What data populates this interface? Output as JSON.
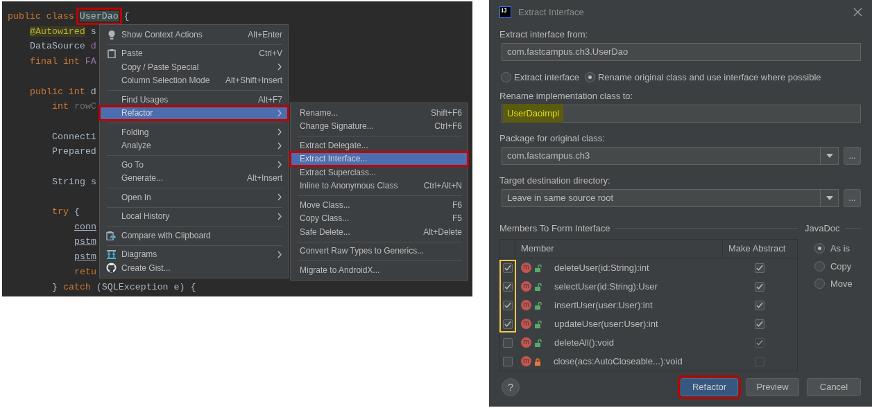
{
  "editor": {
    "code_lines": [
      {
        "tokens": [
          {
            "text": "public class",
            "kind": "keyword"
          },
          {
            "text": "UserDao",
            "kind": "plain",
            "selected": true,
            "outlined": true
          },
          {
            "text": "{",
            "kind": "plain"
          }
        ],
        "children": [
          {
            "tokens": [
              {
                "text": "@Autowired",
                "kind": "annotation"
              },
              {
                "text": "s",
                "kind": "plain"
              }
            ]
          },
          {
            "tokens": [
              {
                "text": "DataSource",
                "kind": "plain"
              },
              {
                "text": "d",
                "kind": "field"
              }
            ]
          },
          {
            "tokens": [
              {
                "text": "final int",
                "kind": "keyword"
              },
              {
                "text": "FA",
                "kind": "field"
              }
            ]
          },
          {
            "blank_before": true,
            "tokens": [
              {
                "text": "public int",
                "kind": "keyword"
              },
              {
                "text": "d",
                "kind": "plain"
              }
            ],
            "children": [
              {
                "tokens": [
                  {
                    "text": "int",
                    "kind": "keyword"
                  },
                  {
                    "text": "rowC",
                    "kind": "unused"
                  }
                ]
              },
              {
                "blank_before": true,
                "tokens": [
                  {
                    "text": "Connecti",
                    "kind": "plain"
                  }
                ]
              },
              {
                "tokens": [
                  {
                    "text": "Prepared",
                    "kind": "plain"
                  }
                ]
              },
              {
                "blank_before": true,
                "tokens": [
                  {
                    "text": "String",
                    "kind": "plain"
                  },
                  {
                    "text": "s",
                    "kind": "plain"
                  }
                ]
              },
              {
                "blank_before": true,
                "tokens": [
                  {
                    "text": "try",
                    "kind": "keyword"
                  },
                  {
                    "text": "{",
                    "kind": "plain"
                  }
                ],
                "children": [
                  {
                    "tokens": [
                      {
                        "text": "conn",
                        "kind": "linked"
                      }
                    ]
                  },
                  {
                    "tokens": [
                      {
                        "text": "pstm",
                        "kind": "linked"
                      }
                    ]
                  },
                  {
                    "tokens": [
                      {
                        "text": "pstm",
                        "kind": "linked"
                      }
                    ]
                  },
                  {
                    "tokens": [
                      {
                        "text": "retu",
                        "kind": "keyword"
                      }
                    ]
                  }
                ]
              },
              {
                "tokens": [
                  {
                    "text": "}",
                    "kind": "plain"
                  },
                  {
                    "text": "catch",
                    "kind": "keyword"
                  },
                  {
                    "text": "(SQLException e) {",
                    "kind": "plain"
                  }
                ]
              }
            ]
          }
        ]
      }
    ]
  },
  "context_menu": {
    "groups": [
      [
        {
          "label": "Show Context Actions",
          "shortcut": "Alt+Enter",
          "kind": "bulb",
          "has_submenu": false,
          "selected": false
        }
      ],
      [
        {
          "label": "Paste",
          "shortcut": "Ctrl+V",
          "kind": "clipboard",
          "has_submenu": false,
          "selected": false
        },
        {
          "label": "Copy / Paste Special",
          "kind": "plain",
          "has_submenu": true,
          "selected": false
        },
        {
          "label": "Column Selection Mode",
          "shortcut": "Alt+Shift+Insert",
          "kind": "plain",
          "has_submenu": false,
          "selected": false
        }
      ],
      [
        {
          "label": "Find Usages",
          "shortcut": "Alt+F7",
          "kind": "plain",
          "has_submenu": false,
          "selected": false
        },
        {
          "label": "Refactor",
          "kind": "plain",
          "has_submenu": true,
          "selected": true,
          "outlined": true
        }
      ],
      [
        {
          "label": "Folding",
          "kind": "plain",
          "has_submenu": true,
          "selected": false
        },
        {
          "label": "Analyze",
          "kind": "plain",
          "has_submenu": true,
          "selected": false
        }
      ],
      [
        {
          "label": "Go To",
          "kind": "plain",
          "has_submenu": true,
          "selected": false
        },
        {
          "label": "Generate...",
          "shortcut": "Alt+Insert",
          "kind": "plain",
          "has_submenu": false,
          "selected": false
        }
      ],
      [
        {
          "label": "Open In",
          "kind": "plain",
          "has_submenu": true,
          "selected": false
        }
      ],
      [
        {
          "label": "Local History",
          "kind": "plain",
          "has_submenu": true,
          "selected": false
        }
      ],
      [
        {
          "label": "Compare with Clipboard",
          "kind": "compare",
          "has_submenu": false,
          "selected": false
        }
      ],
      [
        {
          "label": "Diagrams",
          "kind": "diagram",
          "has_submenu": true,
          "selected": false
        },
        {
          "label": "Create Gist...",
          "kind": "gist",
          "has_submenu": false,
          "selected": false
        }
      ]
    ]
  },
  "submenu": {
    "groups": [
      [
        {
          "label": "Rename...",
          "shortcut": "Shift+F6",
          "selected": false
        },
        {
          "label": "Change Signature...",
          "shortcut": "Ctrl+F6",
          "selected": false
        }
      ],
      [
        {
          "label": "Extract Delegate...",
          "selected": false
        },
        {
          "label": "Extract Interface...",
          "selected": true,
          "outlined": true
        },
        {
          "label": "Extract Superclass...",
          "selected": false
        },
        {
          "label": "Inline to Anonymous Class",
          "shortcut": "Ctrl+Alt+N",
          "selected": false
        }
      ],
      [
        {
          "label": "Move Class...",
          "shortcut": "F6",
          "selected": false
        },
        {
          "label": "Copy Class...",
          "shortcut": "F5",
          "selected": false
        },
        {
          "label": "Safe Delete...",
          "shortcut": "Alt+Delete",
          "selected": false
        }
      ],
      [
        {
          "label": "Convert Raw Types to Generics...",
          "selected": false
        }
      ],
      [
        {
          "label": "Migrate to AndroidX...",
          "selected": false
        }
      ]
    ]
  },
  "dialog": {
    "icon_text": "IJ",
    "title": "Extract Interface",
    "source_label": "Extract interface from:",
    "source_value": "com.fastcampus.ch3.UserDao",
    "mode_options": [
      {
        "label": "Extract interface",
        "selected": false
      },
      {
        "label": "Rename original class and use interface where possible",
        "selected": true
      }
    ],
    "rename_label": "Rename implementation class to:",
    "rename_value": "UserDaoimpl",
    "rename_highlighted": true,
    "package_label": "Package for original class:",
    "package_value": "com.fastcampus.ch3",
    "package_browse": "...",
    "target_label": "Target destination directory:",
    "target_value": "Leave in same source root",
    "target_browse": "...",
    "members_title": "Members To Form Interface",
    "columns": [
      "Member",
      "Make Abstract"
    ],
    "members": [
      {
        "badge": "m",
        "kind": "public",
        "name": "deleteUser(id:String):int",
        "checked": true,
        "outlined": true,
        "abstract_checked": true,
        "abstract_disabled": false
      },
      {
        "badge": "m",
        "kind": "public",
        "name": "selectUser(id:String):User",
        "checked": true,
        "outlined": true,
        "abstract_checked": true,
        "abstract_disabled": false
      },
      {
        "badge": "m",
        "kind": "public",
        "name": "insertUser(user:User):int",
        "checked": true,
        "outlined": true,
        "abstract_checked": true,
        "abstract_disabled": false
      },
      {
        "badge": "m",
        "kind": "public",
        "name": "updateUser(user:User):int",
        "checked": true,
        "outlined": true,
        "abstract_checked": true,
        "abstract_disabled": false
      },
      {
        "badge": "m",
        "kind": "public",
        "name": "deleteAll():void",
        "checked": false,
        "abstract_checked": true,
        "abstract_disabled": true
      },
      {
        "badge": "m",
        "kind": "private",
        "name": "close(acs:AutoCloseable...):void",
        "checked": false,
        "abstract_checked": false,
        "abstract_disabled": true
      }
    ],
    "javadoc_title": "JavaDoc",
    "javadoc_options": [
      {
        "label": "As is",
        "selected": true
      },
      {
        "label": "Copy",
        "selected": false
      },
      {
        "label": "Move",
        "selected": false
      }
    ],
    "help": "?",
    "buttons": [
      {
        "label": "Refactor",
        "kind": "primary",
        "outlined": true
      },
      {
        "label": "Preview",
        "kind": "normal"
      },
      {
        "label": "Cancel",
        "kind": "normal"
      }
    ]
  }
}
